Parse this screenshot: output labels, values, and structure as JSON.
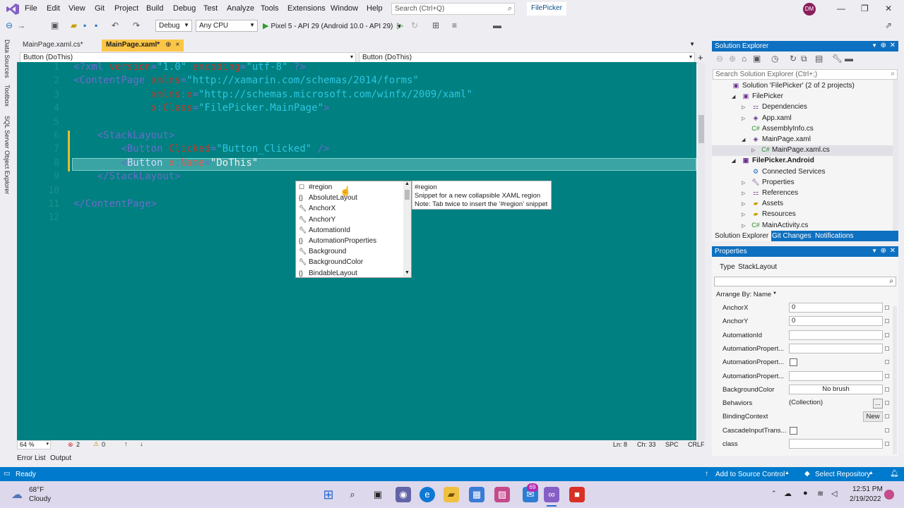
{
  "menu": {
    "items": [
      "File",
      "Edit",
      "View",
      "Git",
      "Project",
      "Build",
      "Debug",
      "Test",
      "Analyze",
      "Tools",
      "Extensions",
      "Window",
      "Help"
    ],
    "search_placeholder": "Search (Ctrl+Q)",
    "app_name": "FilePicker",
    "user_initials": "DM"
  },
  "toolbar": {
    "config": "Debug",
    "platform": "Any CPU",
    "run_target": "Pixel 5 - API 29 (Android 10.0 - API 29)"
  },
  "left_rail": [
    "Data Sources",
    "Toolbox",
    "SQL Server Object Explorer"
  ],
  "tabs": [
    {
      "label": "MainPage.xaml.cs*"
    },
    {
      "label": "MainPage.xaml*",
      "pin": "⊕",
      "close": "×"
    }
  ],
  "navbar": {
    "left": "Button (DoThis)",
    "right": "Button (DoThis)"
  },
  "editor": {
    "line_numbers": [
      "1",
      "2",
      "3",
      "4",
      "5",
      "6",
      "7",
      "8",
      "9",
      "10",
      "11",
      "12"
    ],
    "lines": [
      {
        "parts": [
          [
            "br",
            "<?"
          ],
          [
            "tag",
            "xml"
          ],
          [
            "attr",
            " version"
          ],
          [
            "br",
            "="
          ],
          [
            "val",
            "\"1.0\""
          ],
          [
            "attr",
            " encoding"
          ],
          [
            "br",
            "="
          ],
          [
            "val",
            "\"utf-8\""
          ],
          [
            "br",
            " ?>"
          ]
        ]
      },
      {
        "parts": [
          [
            "br",
            "<"
          ],
          [
            "tag",
            "ContentPage"
          ],
          [
            "attr",
            " xmlns"
          ],
          [
            "br",
            "="
          ],
          [
            "val",
            "\"http://xamarin.com/schemas/2014/forms\""
          ]
        ]
      },
      {
        "parts": [
          [
            "plain",
            "             "
          ],
          [
            "attr",
            "xmlns"
          ],
          [
            "br",
            ":"
          ],
          [
            "attr",
            "x"
          ],
          [
            "br",
            "="
          ],
          [
            "val",
            "\"http://schemas.microsoft.com/winfx/2009/xaml\""
          ]
        ]
      },
      {
        "parts": [
          [
            "plain",
            "             "
          ],
          [
            "attr",
            "x"
          ],
          [
            "br",
            ":"
          ],
          [
            "attr",
            "Class"
          ],
          [
            "br",
            "="
          ],
          [
            "val",
            "\"FilePicker.MainPage\""
          ],
          [
            "br",
            ">"
          ]
        ]
      },
      {
        "parts": []
      },
      {
        "parts": [
          [
            "plain",
            "    "
          ],
          [
            "br",
            "<"
          ],
          [
            "tag",
            "StackLayout"
          ],
          [
            "br",
            ">"
          ]
        ]
      },
      {
        "parts": [
          [
            "plain",
            "        "
          ],
          [
            "br",
            "<"
          ],
          [
            "tag",
            "Button"
          ],
          [
            "attr",
            " Clicked"
          ],
          [
            "br",
            "="
          ],
          [
            "val",
            "\"Button_Clicked\""
          ],
          [
            "br",
            " />"
          ]
        ]
      },
      {
        "parts": [
          [
            "plain",
            "        "
          ],
          [
            "br",
            "<"
          ],
          [
            "tag",
            "Button"
          ],
          [
            "attr",
            " x"
          ],
          [
            "br",
            ":"
          ],
          [
            "attr",
            "Name"
          ],
          [
            "br",
            "="
          ],
          [
            "val",
            "\"DoThis\""
          ]
        ]
      },
      {
        "parts": [
          [
            "plain",
            "    "
          ],
          [
            "br",
            "</"
          ],
          [
            "tag",
            "StackLayout"
          ],
          [
            "br",
            ">"
          ]
        ]
      },
      {
        "parts": []
      },
      {
        "parts": [
          [
            "br",
            "</"
          ],
          [
            "tag",
            "ContentPage"
          ],
          [
            "br",
            ">"
          ]
        ]
      },
      {
        "parts": []
      }
    ]
  },
  "intellisense": {
    "items": [
      {
        "icon": "snippet",
        "label": "#region"
      },
      {
        "icon": "braces",
        "label": "AbsoluteLayout"
      },
      {
        "icon": "wrench",
        "label": "AnchorX"
      },
      {
        "icon": "wrench",
        "label": "AnchorY"
      },
      {
        "icon": "wrench",
        "label": "AutomationId"
      },
      {
        "icon": "braces",
        "label": "AutomationProperties"
      },
      {
        "icon": "wrench",
        "label": "Background"
      },
      {
        "icon": "wrench",
        "label": "BackgroundColor"
      },
      {
        "icon": "braces",
        "label": "BindableLayout"
      }
    ],
    "tooltip": [
      "#region",
      "Snippet for a new collapsible XAML region",
      "Note: Tab twice to insert the '#region' snippet"
    ]
  },
  "editor_status": {
    "zoom": "64 %",
    "errors": "2",
    "warnings": "0",
    "line": "Ln: 8",
    "col": "Ch: 33",
    "spc": "SPC",
    "crlf": "CRLF"
  },
  "output_tabs": [
    "Error List",
    "Output"
  ],
  "status_bar": {
    "left": "Ready",
    "source_control": "Add to Source Control",
    "repo": "Select Repository"
  },
  "solution_explorer": {
    "title": "Solution Explorer",
    "search_placeholder": "Search Solution Explorer (Ctrl+;)",
    "tree": [
      {
        "label": "Solution 'FilePicker' (2 of 2 projects)",
        "level": 0,
        "icon": "sln"
      },
      {
        "label": "FilePicker",
        "level": 1,
        "icon": "proj",
        "exp": "open"
      },
      {
        "label": "Dependencies",
        "level": 2,
        "icon": "deps",
        "exp": "closed"
      },
      {
        "label": "App.xaml",
        "level": 2,
        "icon": "xaml",
        "exp": "closed"
      },
      {
        "label": "AssemblyInfo.cs",
        "level": 2,
        "icon": "cs"
      },
      {
        "label": "MainPage.xaml",
        "level": 2,
        "icon": "xaml",
        "exp": "open"
      },
      {
        "label": "MainPage.xaml.cs",
        "level": 3,
        "icon": "cs",
        "exp": "closed",
        "selected": true
      },
      {
        "label": "FilePicker.Android",
        "level": 1,
        "icon": "proj",
        "exp": "open",
        "bold": true
      },
      {
        "label": "Connected Services",
        "level": 2,
        "icon": "svc"
      },
      {
        "label": "Properties",
        "level": 2,
        "icon": "wrench",
        "exp": "closed"
      },
      {
        "label": "References",
        "level": 2,
        "icon": "deps",
        "exp": "closed"
      },
      {
        "label": "Assets",
        "level": 2,
        "icon": "folder",
        "exp": "closed"
      },
      {
        "label": "Resources",
        "level": 2,
        "icon": "folder",
        "exp": "closed"
      },
      {
        "label": "MainActivity.cs",
        "level": 2,
        "icon": "cs",
        "exp": "closed"
      }
    ],
    "tabs": [
      "Solution Explorer",
      "Git Changes",
      "Notifications"
    ]
  },
  "properties": {
    "title": "Properties",
    "type_label": "Type",
    "type_value": "StackLayout",
    "arrange": "Arrange By: Name",
    "rows": [
      {
        "name": "AnchorX",
        "kind": "text",
        "value": "0"
      },
      {
        "name": "AnchorY",
        "kind": "text",
        "value": "0"
      },
      {
        "name": "AutomationId",
        "kind": "text",
        "value": ""
      },
      {
        "name": "AutomationPropert...",
        "kind": "text",
        "value": ""
      },
      {
        "name": "AutomationPropert...",
        "kind": "check",
        "value": ""
      },
      {
        "name": "AutomationPropert...",
        "kind": "text",
        "value": ""
      },
      {
        "name": "BackgroundColor",
        "kind": "brush",
        "value": "No brush"
      },
      {
        "name": "Behaviors",
        "kind": "collection",
        "value": "(Collection)"
      },
      {
        "name": "BindingContext",
        "kind": "new",
        "value": "New"
      },
      {
        "name": "CascadeInputTrans...",
        "kind": "check",
        "value": ""
      },
      {
        "name": "class",
        "kind": "text",
        "value": ""
      }
    ]
  },
  "taskbar": {
    "weather_temp": "68°F",
    "weather_desc": "Cloudy",
    "time": "12:51 PM",
    "date": "2/19/2022",
    "badge": "69"
  },
  "colors": {
    "editor_bg": "#008080",
    "accent": "#007acc",
    "panel_header": "#0e70c0",
    "active_tab": "#fbc547"
  }
}
